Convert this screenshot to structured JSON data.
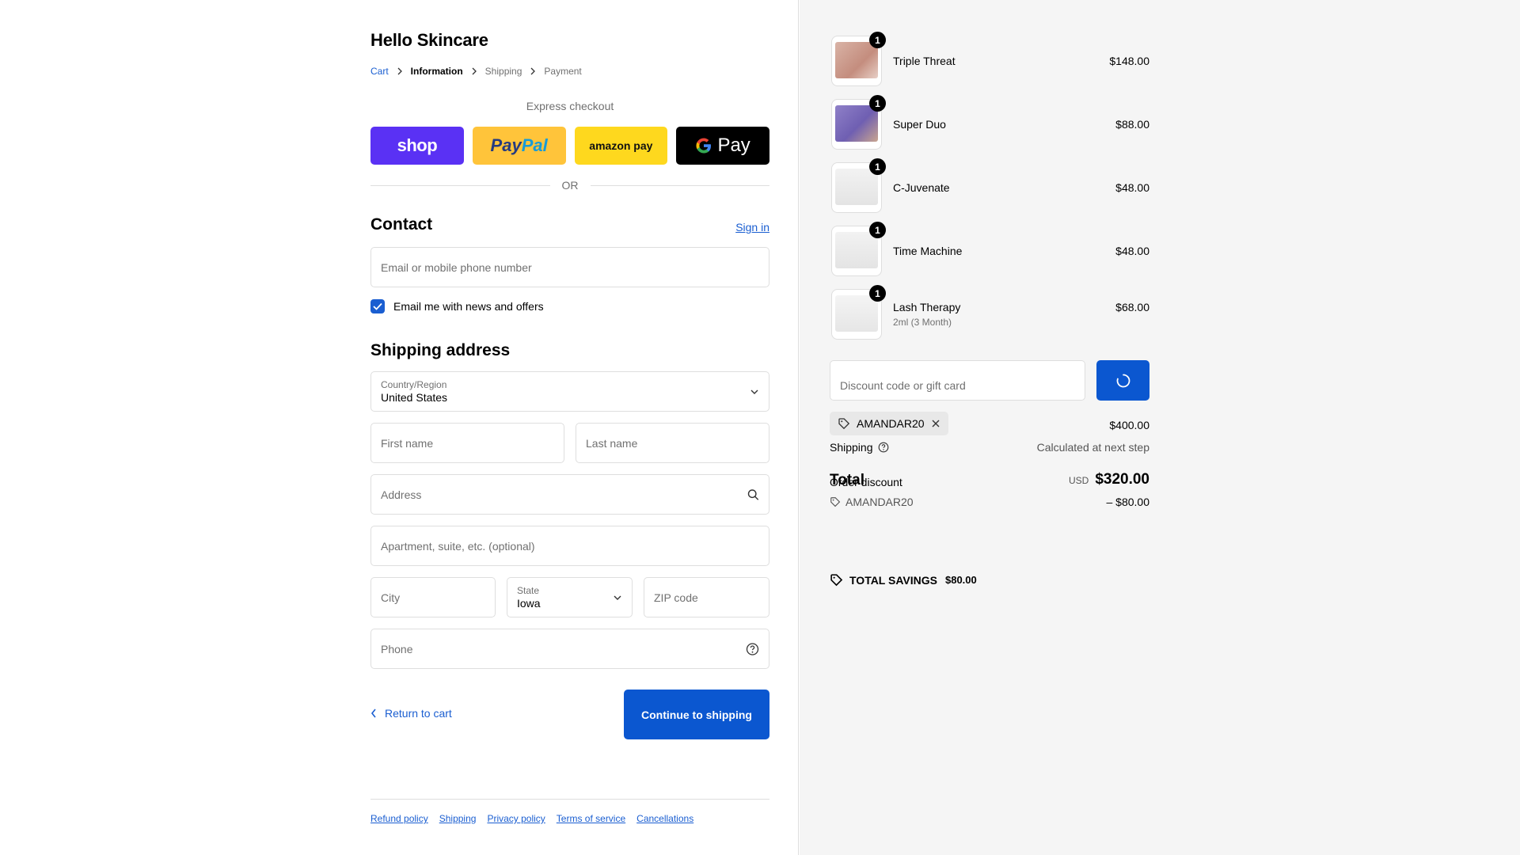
{
  "store": {
    "name": "Hello Skincare"
  },
  "breadcrumb": {
    "cart": "Cart",
    "information": "Information",
    "shipping": "Shipping",
    "payment": "Payment"
  },
  "express": {
    "title": "Express checkout",
    "shop_label": "shop",
    "paypal_label_1": "Pay",
    "paypal_label_2": "Pal",
    "amazon_label": "amazon pay",
    "gpay_label": "Pay",
    "or_label": "OR"
  },
  "contact": {
    "title": "Contact",
    "signin_label": "Sign in",
    "email_placeholder": "Email or mobile phone number",
    "newsletter_label": "Email me with news and offers"
  },
  "shipping_address": {
    "title": "Shipping address",
    "country_label": "Country/Region",
    "country_value": "United States",
    "first_name_placeholder": "First name",
    "last_name_placeholder": "Last name",
    "address_placeholder": "Address",
    "apartment_placeholder": "Apartment, suite, etc. (optional)",
    "city_placeholder": "City",
    "state_label": "State",
    "state_value": "Iowa",
    "zip_placeholder": "ZIP code",
    "phone_placeholder": "Phone"
  },
  "actions": {
    "return_label": "Return to cart",
    "continue_label": "Continue to shipping"
  },
  "footer": {
    "links": [
      "Refund policy",
      "Shipping",
      "Privacy policy",
      "Terms of service",
      "Cancellations"
    ]
  },
  "cart_items": [
    {
      "name": "Triple Threat",
      "variant": "",
      "price": "$148.00",
      "qty": "1"
    },
    {
      "name": "Super Duo",
      "variant": "",
      "price": "$88.00",
      "qty": "1"
    },
    {
      "name": "C-Juvenate",
      "variant": "",
      "price": "$48.00",
      "qty": "1"
    },
    {
      "name": "Time Machine",
      "variant": "",
      "price": "$48.00",
      "qty": "1"
    },
    {
      "name": "Lash Therapy",
      "variant": "2ml (3 Month)",
      "price": "$68.00",
      "qty": "1"
    }
  ],
  "summary": {
    "discount_placeholder": "Discount code or gift card",
    "applied_code": "AMANDAR20",
    "subtotal": "$400.00",
    "shipping_label": "Shipping",
    "shipping_value": "Calculated at next step",
    "order_discount_label": "Order discount",
    "total_label": "Total",
    "discount_code": "AMANDAR20",
    "discount_value": "– $80.00",
    "currency": "USD",
    "total_value": "$320.00",
    "savings_label": "TOTAL SAVINGS",
    "savings_value": "$80.00"
  },
  "colors": {
    "accent": "#0b57d0",
    "link": "#1a5ed1",
    "shop": "#5a31f4",
    "paypal": "#ffc43a",
    "amazon": "#fed81e"
  }
}
